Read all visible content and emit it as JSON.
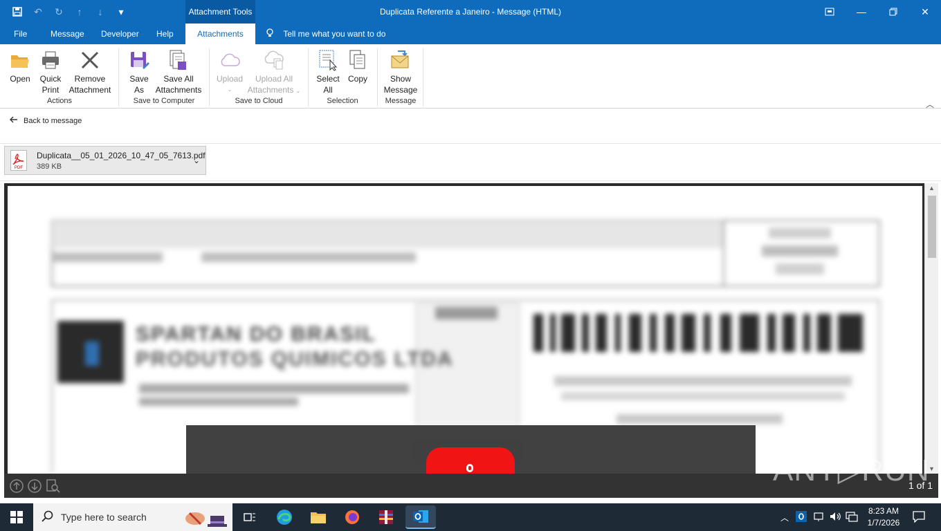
{
  "titlebar": {
    "context_tab": "Attachment Tools",
    "window_title": "Duplicata Referente a Janeiro  -  Message (HTML)",
    "qat_icons": [
      "save-icon",
      "undo-icon",
      "redo-icon",
      "up-icon",
      "down-icon",
      "customize-icon"
    ],
    "window_buttons": [
      "ribbon-display-icon",
      "minimize-icon",
      "restore-icon",
      "close-icon"
    ]
  },
  "tabs": [
    {
      "label": "File"
    },
    {
      "label": "Message"
    },
    {
      "label": "Developer"
    },
    {
      "label": "Help"
    },
    {
      "label": "Attachments"
    }
  ],
  "tell_me": "Tell me what you want to do",
  "ribbon": {
    "open": "Open",
    "quick_print_1": "Quick",
    "quick_print_2": "Print",
    "remove_1": "Remove",
    "remove_2": "Attachment",
    "save_as_1": "Save",
    "save_as_2": "As",
    "save_all_1": "Save All",
    "save_all_2": "Attachments",
    "upload": "Upload",
    "upload_all_1": "Upload All",
    "upload_all_2": "Attachments",
    "select_all_1": "Select",
    "select_all_2": "All",
    "copy": "Copy",
    "show_msg_1": "Show",
    "show_msg_2": "Message",
    "groups": {
      "actions": "Actions",
      "save_to_computer": "Save to Computer",
      "save_to_cloud": "Save to Cloud",
      "selection": "Selection",
      "message": "Message"
    }
  },
  "back_link": "Back to message",
  "attachment": {
    "filename": "Duplicata__05_01_2026_10_47_05_7613.pdf",
    "size": "389 KB",
    "icon_text": "PDF"
  },
  "preview": {
    "blurred_text": [
      "SPARTAN DO BRASIL",
      "PRODUTOS QUIMICOS LTDA"
    ],
    "page_count": "1 of 1",
    "watermark": "ANY▷RUN"
  },
  "taskbar": {
    "search_placeholder": "Type here to search",
    "time": "8:23 AM",
    "date": "1/7/2026"
  },
  "colors": {
    "brand_blue": "#0f6cbd",
    "context_tab": "#0a5aa3",
    "taskbar": "#1f2a37",
    "preview_bg": "#2b2b2b"
  }
}
